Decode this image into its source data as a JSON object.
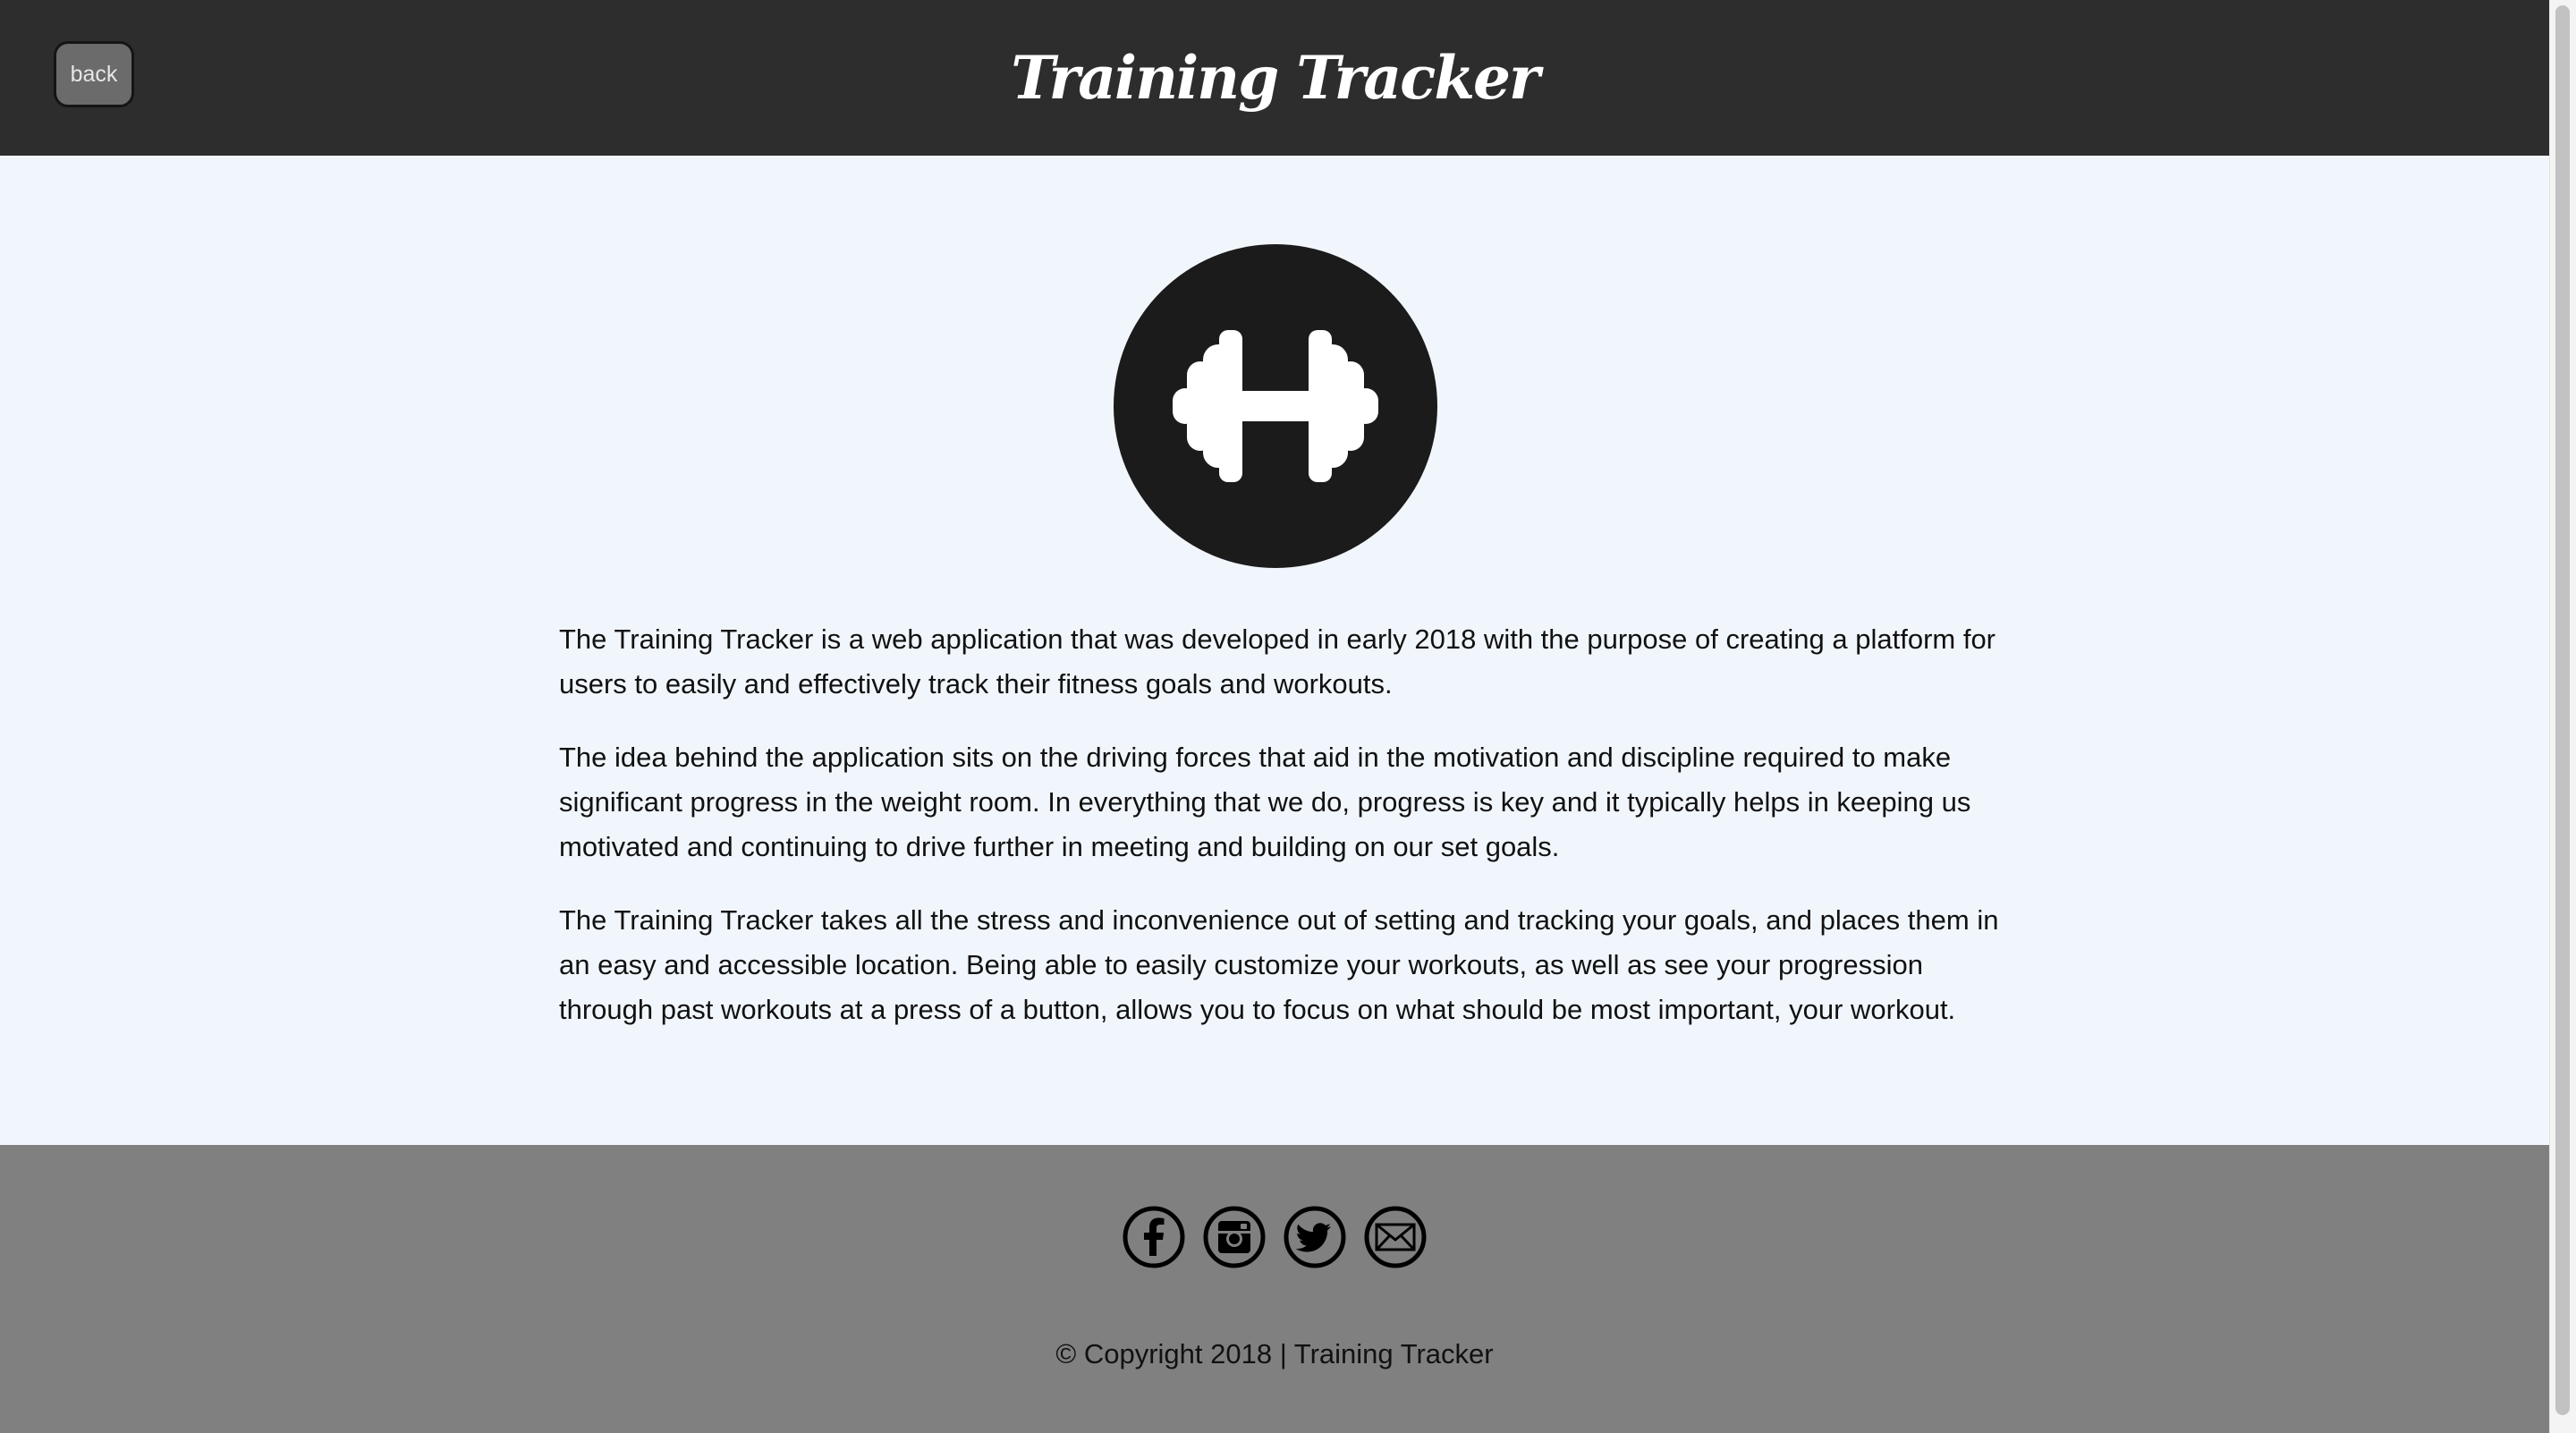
{
  "header": {
    "title": "Training Tracker",
    "back_label": "back",
    "background": "#2d2d2d"
  },
  "logo": {
    "icon": "dumbbell-icon",
    "circle_color": "#1b1b1b",
    "glyph_color": "#ffffff"
  },
  "main": {
    "background": "#f1f6fd",
    "paragraphs": [
      "The Training Tracker is a web application that was developed in early 2018 with the purpose of creating a platform for users to easily and effectively track their fitness goals and workouts.",
      "The idea behind the application sits on the driving forces that aid in the motivation and discipline required to make significant progress in the weight room. In everything that we do, progress is key and it typically helps in keeping us motivated and continuing to drive further in meeting and building on our set goals.",
      "The Training Tracker takes all the stress and inconvenience out of setting and tracking your goals, and places them in an easy and accessible location. Being able to easily customize your workouts, as well as see your progression through past workouts at a press of a button, allows you to focus on what should be most important, your workout."
    ]
  },
  "footer": {
    "background": "#808080",
    "social_icons": [
      "facebook-icon",
      "instagram-icon",
      "twitter-icon",
      "email-icon"
    ],
    "copyright": "© Copyright 2018 | Training Tracker"
  }
}
